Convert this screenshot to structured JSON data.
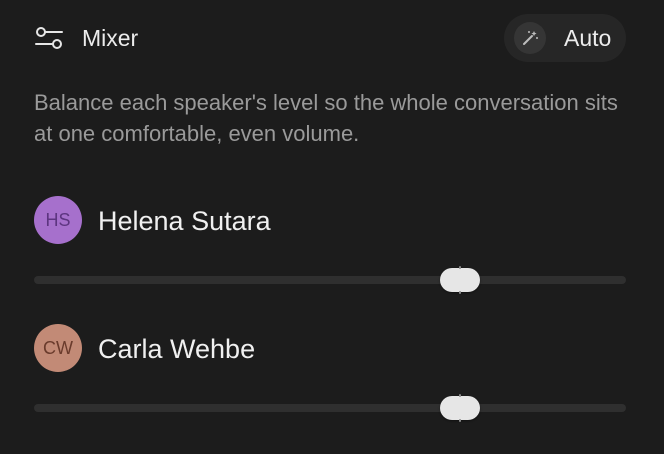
{
  "header": {
    "title": "Mixer",
    "title_icon": "mixer-sliders-icon",
    "auto_label": "Auto",
    "auto_icon": "magic-wand-icon"
  },
  "description": "Balance each speaker's level so the whole conversation sits at one comfortable, even volume.",
  "speakers": [
    {
      "initials": "HS",
      "name": "Helena Sutara",
      "avatar_color": "#a670cc",
      "avatar_text_color": "#5d3580",
      "level": 0.72
    },
    {
      "initials": "CW",
      "name": "Carla Wehbe",
      "avatar_color": "#c28a76",
      "avatar_text_color": "#6a3b2c",
      "level": 0.72
    }
  ],
  "colors": {
    "background": "#1c1c1c",
    "text": "#ececec",
    "muted_text": "#9a9a9a",
    "track": "#2f2f2f",
    "thumb": "#e6e6e6"
  }
}
